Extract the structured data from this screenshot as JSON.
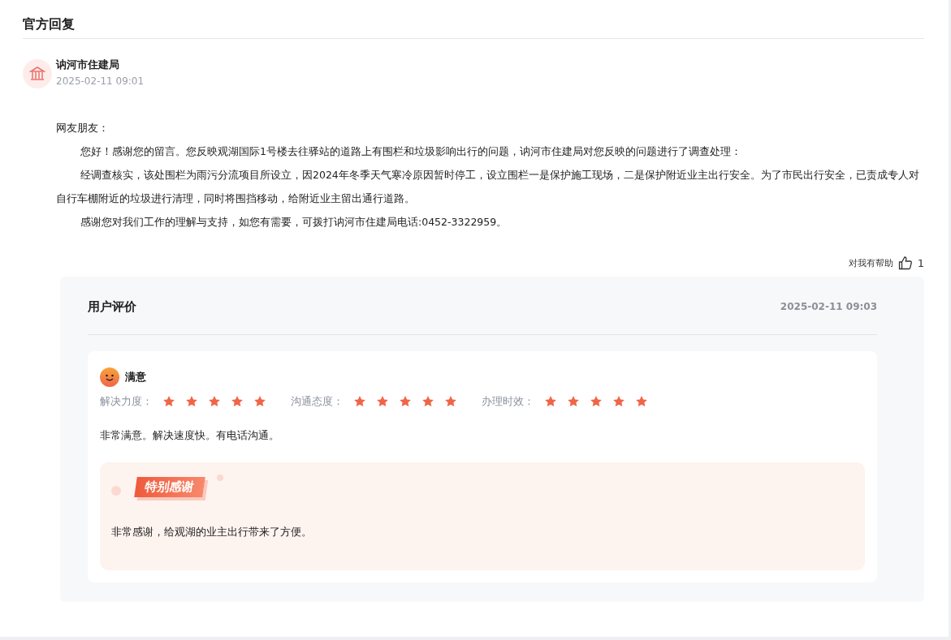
{
  "section_title": "官方回复",
  "reply": {
    "author": "讷河市住建局",
    "time": "2025-02-11 09:01",
    "greeting": "网友朋友：",
    "paragraphs": [
      "您好！感谢您的留言。您反映观湖国际1号楼去往驿站的道路上有围栏和垃圾影响出行的问题，讷河市住建局对您反映的问题进行了调查处理：",
      "经调查核实，该处围栏为雨污分流项目所设立，因2024年冬季天气寒冷原因暂时停工，设立围栏一是保护施工现场，二是保护附近业主出行安全。为了市民出行安全，已责成专人对自行车棚附近的垃圾进行清理，同时将围挡移动，给附近业主留出通行道路。",
      "感谢您对我们工作的理解与支持，如您有需要，可拨打讷河市住建局电话:0452-3322959。"
    ]
  },
  "helpful": {
    "label": "对我有帮助",
    "count": "1"
  },
  "evaluation": {
    "title": "用户评价",
    "time": "2025-02-11 09:03",
    "satisfaction": "满意",
    "ratings": [
      {
        "label": "解决力度：",
        "stars": 5
      },
      {
        "label": "沟通态度：",
        "stars": 5
      },
      {
        "label": "办理时效：",
        "stars": 5
      }
    ],
    "comment": "非常满意。解决速度快。有电话沟通。",
    "thanks": {
      "badge": "特别感谢",
      "text": "非常感谢，给观湖的业主出行带来了方便。"
    }
  }
}
